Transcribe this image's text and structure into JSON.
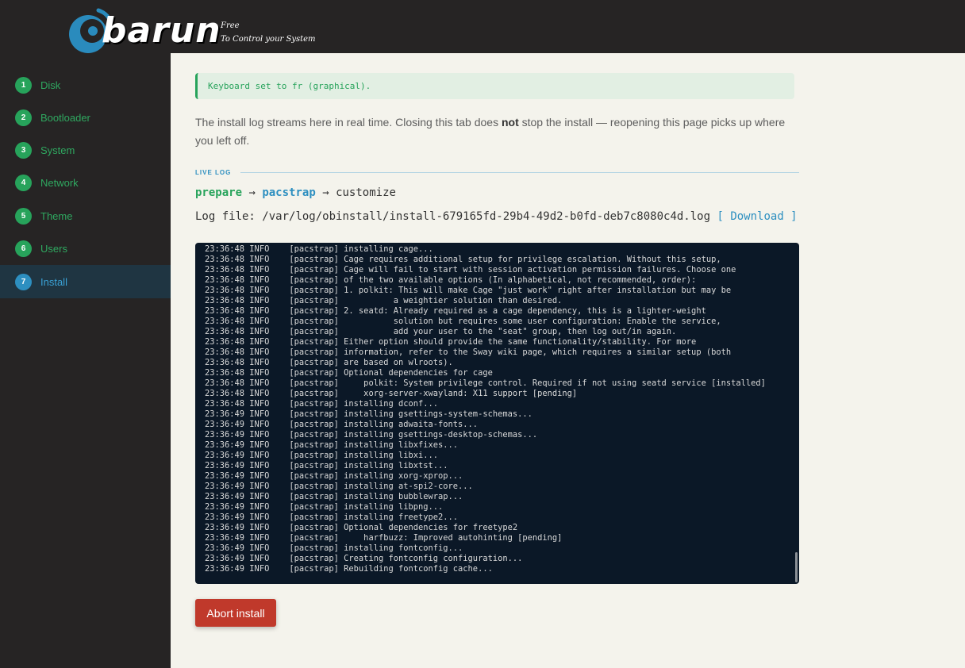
{
  "brand": {
    "name": "barun",
    "tagline_1": "Free",
    "tagline_2": "To Control your System",
    "logo_color": "#2a8bbd"
  },
  "sidebar": {
    "steps": [
      {
        "num": "1",
        "label": "Disk"
      },
      {
        "num": "2",
        "label": "Bootloader"
      },
      {
        "num": "3",
        "label": "System"
      },
      {
        "num": "4",
        "label": "Network"
      },
      {
        "num": "5",
        "label": "Theme"
      },
      {
        "num": "6",
        "label": "Users"
      },
      {
        "num": "7",
        "label": "Install"
      }
    ],
    "active_step": "Install"
  },
  "notice": "Keyboard set to fr (graphical).",
  "intro": {
    "before": "The install log streams here in real time. Closing this tab does ",
    "emphasis": "not",
    "after": " stop the install — reopening this page picks up where you left off."
  },
  "live_log": {
    "heading": "LIVE LOG",
    "pipeline": {
      "stages": [
        "prepare",
        "pacstrap",
        "customize"
      ],
      "arrow": "→"
    },
    "log_file_label": "Log file: ",
    "log_file_path": "/var/log/obinstall/install-679165fd-29b4-49d2-b0fd-deb7c8080c4d.log",
    "download_label": "[ Download ]",
    "lines": [
      "23:36:48 INFO    [pacstrap] installing cage...",
      "23:36:48 INFO    [pacstrap] Cage requires additional setup for privilege escalation. Without this setup,",
      "23:36:48 INFO    [pacstrap] Cage will fail to start with session activation permission failures. Choose one",
      "23:36:48 INFO    [pacstrap] of the two available options (In alphabetical, not recommended, order):",
      "23:36:48 INFO    [pacstrap] 1. polkit: This will make Cage \"just work\" right after installation but may be",
      "23:36:48 INFO    [pacstrap]           a weightier solution than desired.",
      "23:36:48 INFO    [pacstrap] 2. seatd: Already required as a cage dependency, this is a lighter-weight",
      "23:36:48 INFO    [pacstrap]           solution but requires some user configuration: Enable the service,",
      "23:36:48 INFO    [pacstrap]           add your user to the \"seat\" group, then log out/in again.",
      "23:36:48 INFO    [pacstrap] Either option should provide the same functionality/stability. For more",
      "23:36:48 INFO    [pacstrap] information, refer to the Sway wiki page, which requires a similar setup (both",
      "23:36:48 INFO    [pacstrap] are based on wlroots).",
      "23:36:48 INFO    [pacstrap] Optional dependencies for cage",
      "23:36:48 INFO    [pacstrap]     polkit: System privilege control. Required if not using seatd service [installed]",
      "23:36:48 INFO    [pacstrap]     xorg-server-xwayland: X11 support [pending]",
      "23:36:48 INFO    [pacstrap] installing dconf...",
      "23:36:49 INFO    [pacstrap] installing gsettings-system-schemas...",
      "23:36:49 INFO    [pacstrap] installing adwaita-fonts...",
      "23:36:49 INFO    [pacstrap] installing gsettings-desktop-schemas...",
      "23:36:49 INFO    [pacstrap] installing libxfixes...",
      "23:36:49 INFO    [pacstrap] installing libxi...",
      "23:36:49 INFO    [pacstrap] installing libxtst...",
      "23:36:49 INFO    [pacstrap] installing xorg-xprop...",
      "23:36:49 INFO    [pacstrap] installing at-spi2-core...",
      "23:36:49 INFO    [pacstrap] installing bubblewrap...",
      "23:36:49 INFO    [pacstrap] installing libpng...",
      "23:36:49 INFO    [pacstrap] installing freetype2...",
      "23:36:49 INFO    [pacstrap] Optional dependencies for freetype2",
      "23:36:49 INFO    [pacstrap]     harfbuzz: Improved autohinting [pending]",
      "23:36:49 INFO    [pacstrap] installing fontconfig...",
      "23:36:49 INFO    [pacstrap] Creating fontconfig configuration...",
      "23:36:49 INFO    [pacstrap] Rebuilding fontconfig cache..."
    ]
  },
  "abort_label": "Abort install",
  "colors": {
    "accent_green": "#27a35b",
    "accent_blue": "#2d8fc0",
    "danger": "#c0392b",
    "sidebar_bg": "#262424",
    "terminal_bg": "#0b1827"
  }
}
